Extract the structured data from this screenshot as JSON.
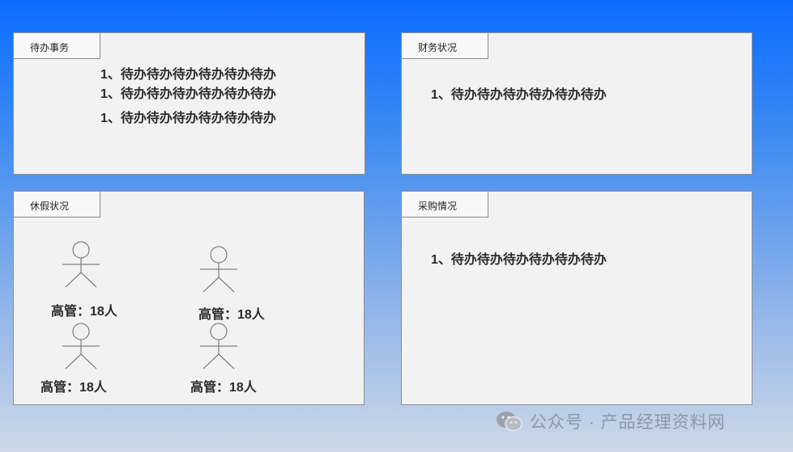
{
  "panels": {
    "todo": {
      "tab": "待办事务",
      "items": [
        "1、待办待办待办待办待办待办",
        "1、待办待办待办待办待办待办",
        "1、待办待办待办待办待办待办"
      ]
    },
    "finance": {
      "tab": "财务状况",
      "items": [
        "1、待办待办待办待办待办待办"
      ]
    },
    "leave": {
      "tab": "休假状况",
      "people": [
        {
          "caption": "高管：18人"
        },
        {
          "caption": "高管：18人"
        },
        {
          "caption": "高管：18人"
        },
        {
          "caption": "高管：18人"
        }
      ]
    },
    "purchase": {
      "tab": "采购情况",
      "items": [
        "1、待办待办待办待办待办待办"
      ]
    }
  },
  "watermark": {
    "text": "公众号 · 产品经理资料网",
    "icon": "wechat-icon"
  }
}
